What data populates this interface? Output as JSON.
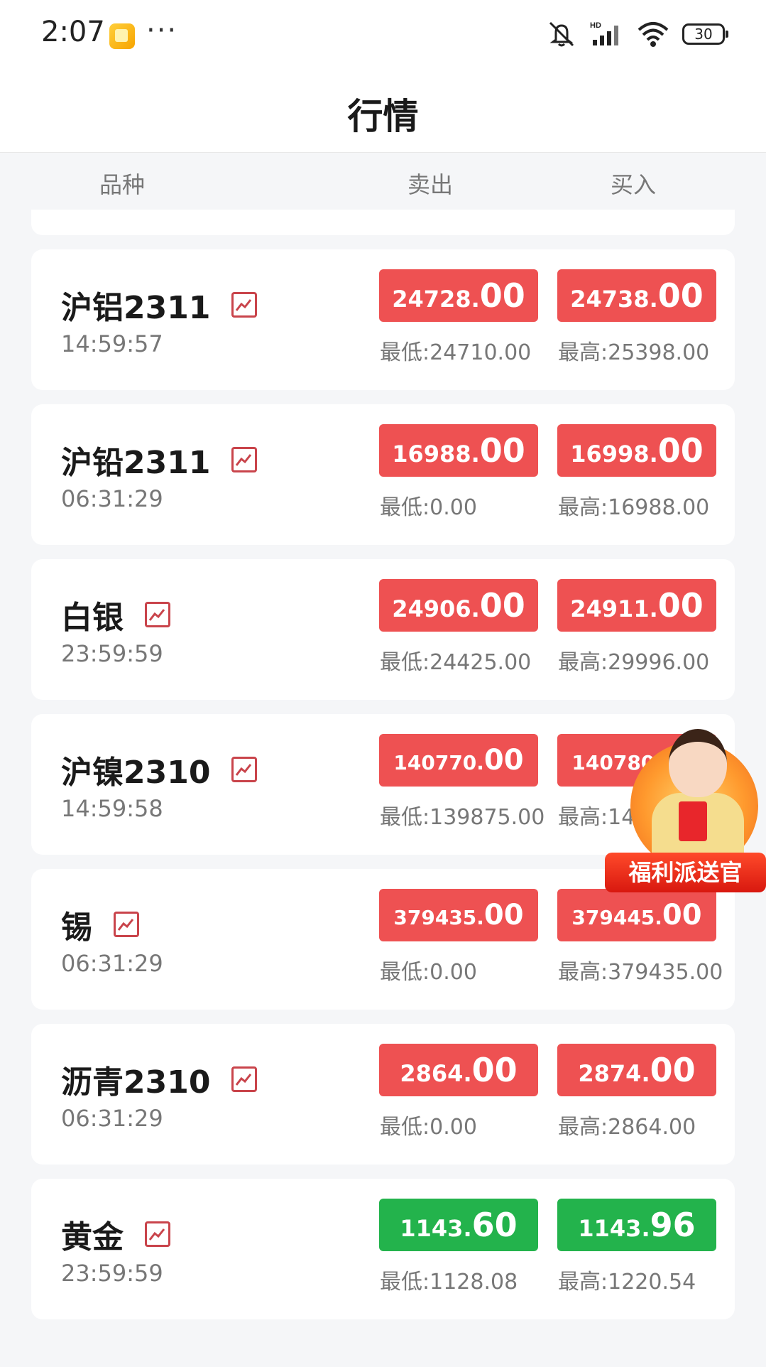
{
  "status_bar": {
    "time": "2:07",
    "more": "···",
    "network": "HD",
    "battery": "30"
  },
  "header": {
    "title": "行情"
  },
  "columns": {
    "name": "品种",
    "sell": "卖出",
    "buy": "买入"
  },
  "quotes": [
    {
      "name": "沪铝2311",
      "time": "14:59:57",
      "sell_int": "24728.",
      "sell_dec": "00",
      "buy_int": "24738.",
      "buy_dec": "00",
      "low": "最低:24710.00",
      "high": "最高:25398.00",
      "color": "red"
    },
    {
      "name": "沪铅2311",
      "time": "06:31:29",
      "sell_int": "16988.",
      "sell_dec": "00",
      "buy_int": "16998.",
      "buy_dec": "00",
      "low": "最低:0.00",
      "high": "最高:16988.00",
      "color": "red"
    },
    {
      "name": "白银",
      "time": "23:59:59",
      "sell_int": "24906.",
      "sell_dec": "00",
      "buy_int": "24911.",
      "buy_dec": "00",
      "low": "最低:24425.00",
      "high": "最高:29996.00",
      "color": "red"
    },
    {
      "name": "沪镍2310",
      "time": "14:59:58",
      "sell_int": "140770.",
      "sell_dec": "00",
      "buy_int": "140780.",
      "buy_dec": "00",
      "low": "最低:139875.00",
      "high": "最高:145",
      "color": "red"
    },
    {
      "name": "锡",
      "time": "06:31:29",
      "sell_int": "379435.",
      "sell_dec": "00",
      "buy_int": "379445.",
      "buy_dec": "00",
      "low": "最低:0.00",
      "high": "最高:379435.00",
      "color": "red"
    },
    {
      "name": "沥青2310",
      "time": "06:31:29",
      "sell_int": "2864.",
      "sell_dec": "00",
      "buy_int": "2874.",
      "buy_dec": "00",
      "low": "最低:0.00",
      "high": "最高:2864.00",
      "color": "red"
    },
    {
      "name": "黄金",
      "time": "23:59:59",
      "sell_int": "1143.",
      "sell_dec": "60",
      "buy_int": "1143.",
      "buy_dec": "96",
      "low": "最低:1128.08",
      "high": "最高:1220.54",
      "color": "green"
    }
  ],
  "promo": {
    "label": "福利派送官"
  },
  "colors": {
    "rise": "#ee5152",
    "fall": "#23b34c",
    "chart_icon": "#c9444b"
  },
  "icons": {
    "chart": "trend-chart-icon",
    "mute": "mute-icon",
    "signal": "signal-icon",
    "wifi": "wifi-icon",
    "battery": "battery-icon"
  }
}
